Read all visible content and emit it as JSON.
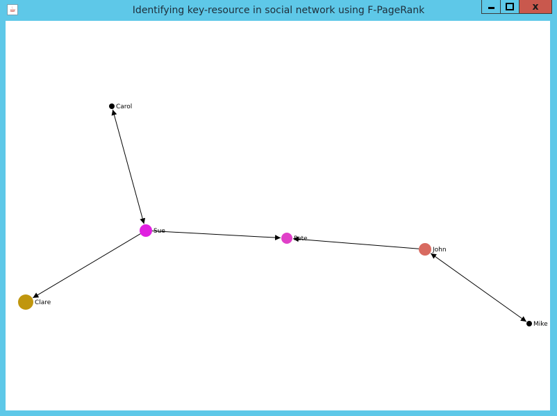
{
  "window": {
    "title": "Identifying key-resource in social network using F-PageRank",
    "close_symbol": "x"
  },
  "graph": {
    "nodes": [
      {
        "id": "carol",
        "label": "Carol",
        "color": "#000000"
      },
      {
        "id": "sue",
        "label": "Sue",
        "color": "#e020e0"
      },
      {
        "id": "pete",
        "label": "Pete",
        "color": "#e040c8"
      },
      {
        "id": "john",
        "label": "John",
        "color": "#d86a60"
      },
      {
        "id": "clare",
        "label": "Clare",
        "color": "#c0960e"
      },
      {
        "id": "mike",
        "label": "Mike",
        "color": "#000000"
      }
    ],
    "edges": [
      {
        "from": "carol",
        "to": "sue",
        "bidirectional": true
      },
      {
        "from": "sue",
        "to": "pete",
        "bidirectional": false
      },
      {
        "from": "john",
        "to": "pete",
        "bidirectional": false
      },
      {
        "from": "sue",
        "to": "clare",
        "bidirectional": false
      },
      {
        "from": "john",
        "to": "mike",
        "bidirectional": true
      }
    ]
  }
}
